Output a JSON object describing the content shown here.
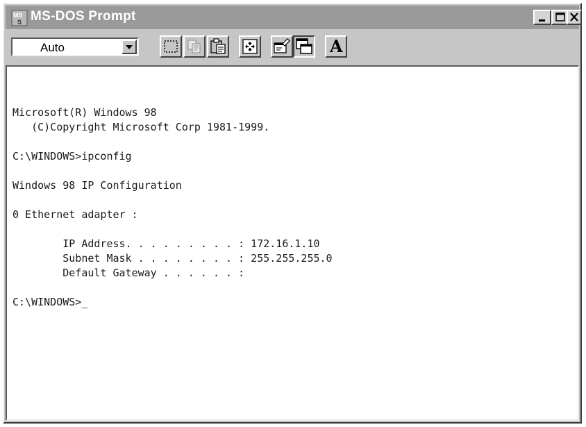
{
  "window": {
    "title": "MS-DOS Prompt",
    "app_icon": "ms-dos-icon",
    "controls": [
      "minimize-icon",
      "maximize-icon",
      "close-icon"
    ]
  },
  "toolbar": {
    "font_size_value": "Auto",
    "buttons": [
      {
        "name": "mark-button",
        "icon": "mark-icon"
      },
      {
        "name": "copy-button",
        "icon": "copy-icon"
      },
      {
        "name": "paste-button",
        "icon": "paste-icon"
      },
      {
        "name": "full-screen-button",
        "icon": "full-screen-icon"
      },
      {
        "name": "properties-button",
        "icon": "properties-icon"
      },
      {
        "name": "background-button",
        "icon": "background-icon"
      },
      {
        "name": "font-button",
        "icon": "font-icon",
        "glyph": "A"
      }
    ]
  },
  "console": {
    "lines": [
      "Microsoft(R) Windows 98",
      "   (C)Copyright Microsoft Corp 1981-1999.",
      "",
      "C:\\WINDOWS>ipconfig",
      "",
      "Windows 98 IP Configuration",
      "",
      "0 Ethernet adapter :",
      "",
      "        IP Address. . . . . . . . . : 172.16.1.10",
      "        Subnet Mask . . . . . . . . : 255.255.255.0",
      "        Default Gateway . . . . . . :",
      "",
      "C:\\WINDOWS>_"
    ]
  }
}
